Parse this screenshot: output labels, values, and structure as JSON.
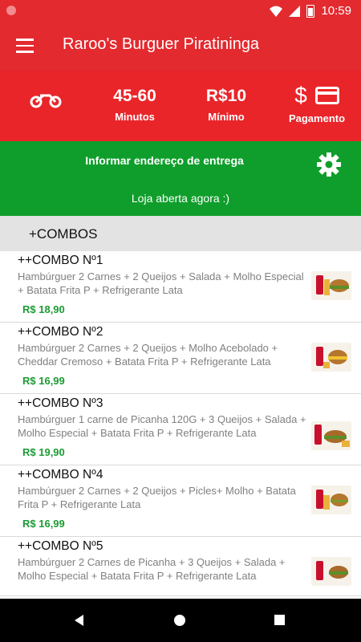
{
  "status_bar": {
    "time": "10:59"
  },
  "app_bar": {
    "title": "Raroo's Burguer Piratininga"
  },
  "info_bar": {
    "delivery_time": "45-60",
    "delivery_time_label": "Minutos",
    "minimum_value": "R$10",
    "minimum_label": "Mínimo",
    "payment_label": "Pagamento"
  },
  "address_bar": {
    "inform_address_label": "Informar endereço de entrega",
    "store_status": "Loja aberta agora :)"
  },
  "section": {
    "title": "+COMBOS"
  },
  "menu_items": [
    {
      "name": "++COMBO Nº1",
      "description": "Hambúrguer 2 Carnes + 2 Queijos + Salada + Molho Especial + Batata Frita P + Refrigerante Lata",
      "price": "R$ 18,90"
    },
    {
      "name": "++COMBO Nº2",
      "description": "Hambúrguer 2 Carnes + 2 Queijos + Molho Acebolado + Cheddar Cremoso + Batata Frita P + Refrigerante Lata",
      "price": "R$ 16,99"
    },
    {
      "name": "++COMBO Nº3",
      "description": "Hambúrguer 1 carne de Picanha 120G + 3 Queijos + Salada + Molho Especial + Batata Frita P + Refrigerante Lata",
      "price": "R$ 19,90"
    },
    {
      "name": "++COMBO Nº4",
      "description": "Hambúrguer 2 Carnes + 2 Queijos + Picles+ Molho + Batata Frita P + Refrigerante Lata",
      "price": "R$ 16,99"
    },
    {
      "name": "++COMBO Nº5",
      "description": "Hambúrguer 2 Carnes de Picanha  + 3 Queijos + Salada + Molho Especial + Batata Frita P + Refrigerante Lata",
      "price": ""
    }
  ],
  "colors": {
    "primary_red": "#e32a2f",
    "green": "#0f9e2b",
    "price_green": "#1a9b33"
  }
}
